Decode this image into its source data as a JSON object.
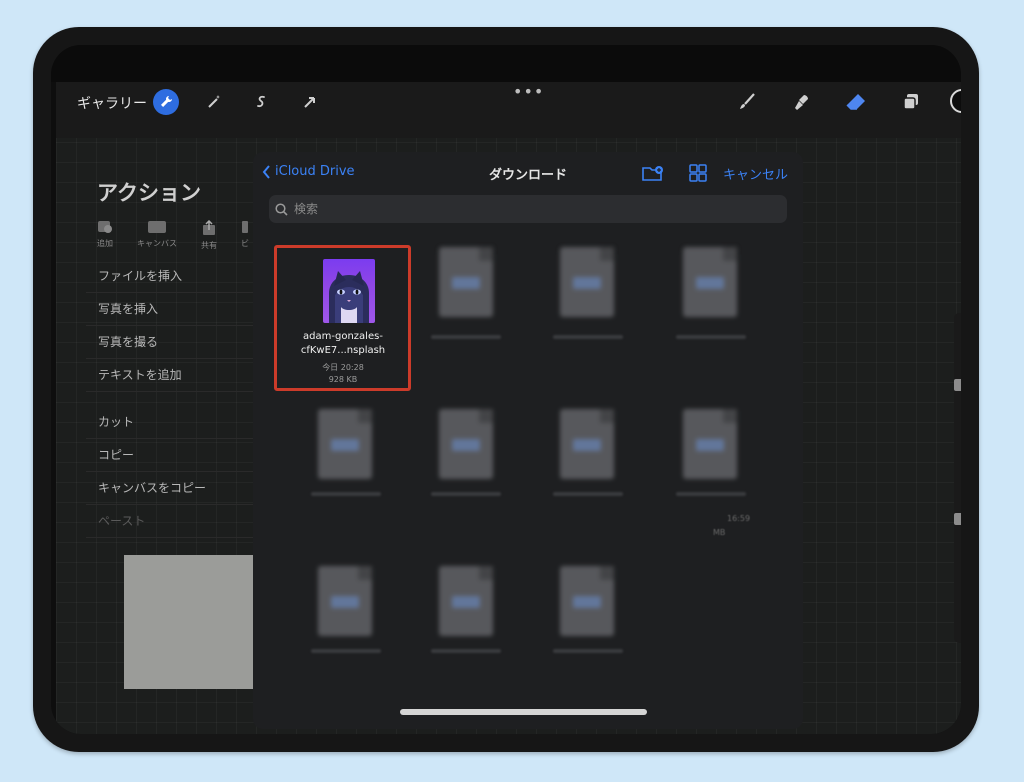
{
  "toolbar": {
    "gallery_label": "ギャラリー",
    "icons": [
      "wrench-icon",
      "magic-wand-icon",
      "selection-icon",
      "transform-arrow-icon",
      "brush-icon",
      "smudge-icon",
      "eraser-icon",
      "layers-icon",
      "color-swatch-icon"
    ],
    "dots": "•••",
    "accent_color": "#2e6de0",
    "eraser_color": "#4e86f0"
  },
  "actions_panel": {
    "title": "アクション",
    "tabs": [
      {
        "label": "追加",
        "icon": "add-icon"
      },
      {
        "label": "キャンバス",
        "icon": "canvas-icon"
      },
      {
        "label": "共有",
        "icon": "share-icon"
      },
      {
        "label": "ビ",
        "icon": "video-icon"
      }
    ],
    "items_group1": [
      "ファイルを挿入",
      "写真を挿入",
      "写真を撮る",
      "テキストを追加"
    ],
    "items_group2": [
      "カット",
      "コピー",
      "キャンバスをコピー"
    ],
    "disabled_item": "ペースト"
  },
  "file_picker": {
    "back_label": "iCloud Drive",
    "title": "ダウンロード",
    "new_folder_icon": "folder-badge-plus-icon",
    "grid_icon": "grid-icon",
    "cancel_label": "キャンセル",
    "search_placeholder": "検索",
    "files": [
      {
        "name_line1": "adam-gonzales-",
        "name_line2": "cfKwE7...nsplash",
        "date": "今日 20:28",
        "size": "928 KB"
      }
    ],
    "blurred_partial_meta": {
      "time": "16:59",
      "unit": "MB"
    }
  },
  "colors": {
    "link": "#3b82f6",
    "highlight_border": "#cc3b2a",
    "page_background": "#cfe7f8"
  }
}
